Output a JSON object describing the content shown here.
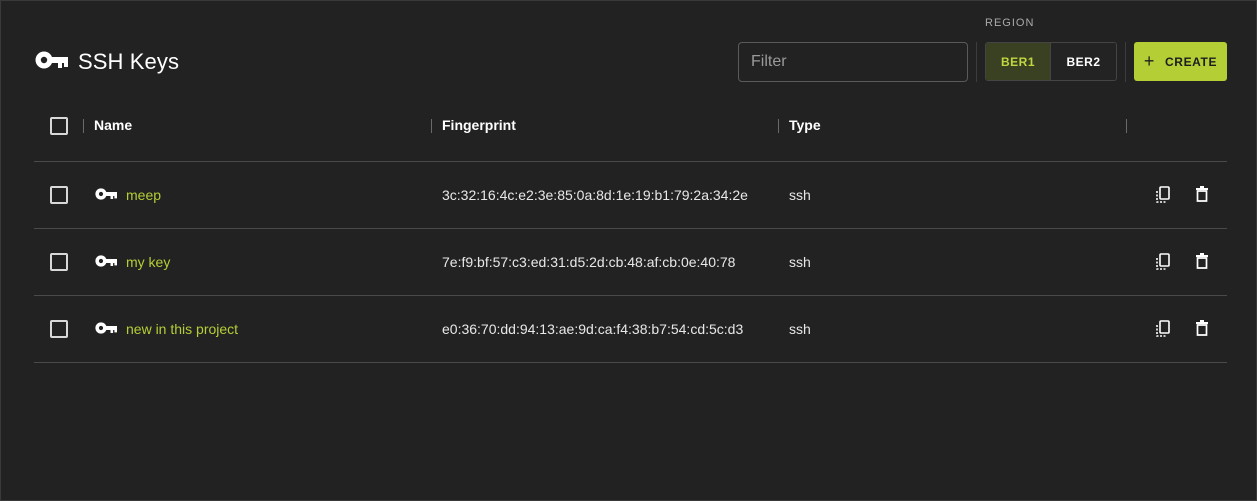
{
  "header": {
    "title": "SSH Keys",
    "title_icon": "key-icon",
    "filter_placeholder": "Filter",
    "filter_value": "",
    "region_label": "REGION",
    "regions": [
      {
        "label": "BER1",
        "active": true
      },
      {
        "label": "BER2",
        "active": false
      }
    ],
    "create_label": "CREATE",
    "create_icon": "plus-icon"
  },
  "table": {
    "columns": [
      "Name",
      "Fingerprint",
      "Type"
    ],
    "rows": [
      {
        "name": "meep",
        "fingerprint": "3c:32:16:4c:e2:3e:85:0a:8d:1e:19:b1:79:2a:34:2e",
        "type": "ssh"
      },
      {
        "name": "my key",
        "fingerprint": "7e:f9:bf:57:c3:ed:31:d5:2d:cb:48:af:cb:0e:40:78",
        "type": "ssh"
      },
      {
        "name": "new in this project",
        "fingerprint": "e0:36:70:dd:94:13:ae:9d:ca:f4:38:b7:54:cd:5c:d3",
        "type": "ssh"
      }
    ],
    "row_actions": [
      "copy-icon",
      "trash-icon"
    ]
  },
  "colors": {
    "accent": "#b3cf35",
    "background": "#222222",
    "active_region_bg": "#3a4022"
  }
}
